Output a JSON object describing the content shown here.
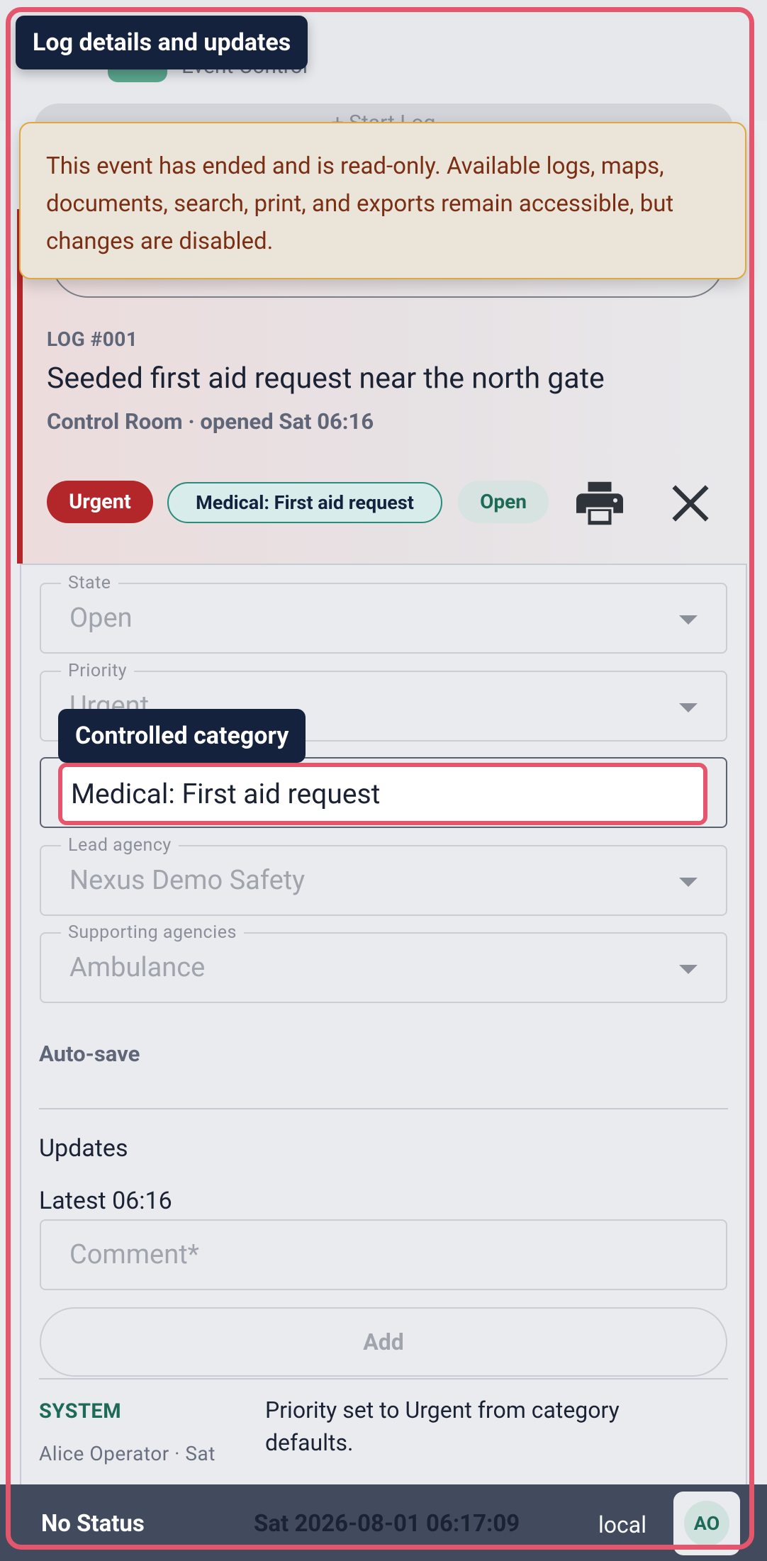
{
  "tooltips": {
    "top": "Log details and updates",
    "category": "Controlled category"
  },
  "background": {
    "app_name": "Event Control",
    "start_log": "+ Start Log"
  },
  "banner": {
    "text": "This event has ended and is read-only. Available logs, maps, documents, search, print, and exports remain accessible, but changes are disabled."
  },
  "log": {
    "number": "LOG #001",
    "title": "Seeded first aid request near the north gate",
    "subtitle": "Control Room · opened Sat 06:16",
    "chips": {
      "priority": "Urgent",
      "category": "Medical: First aid request",
      "state": "Open"
    },
    "icons": {
      "print": "print-icon",
      "close": "close-icon"
    }
  },
  "form": {
    "state": {
      "label": "State",
      "value": "Open"
    },
    "priority": {
      "label": "Priority",
      "value": "Urgent"
    },
    "category": {
      "value": "Medical: First aid request"
    },
    "lead_agency": {
      "label": "Lead agency",
      "value": "Nexus Demo Safety"
    },
    "supporting_agencies": {
      "label": "Supporting agencies",
      "value": "Ambulance"
    },
    "autosave": "Auto-save"
  },
  "updates": {
    "heading": "Updates",
    "latest": "Latest 06:16",
    "comment_placeholder": "Comment*",
    "add_label": "Add",
    "entries": [
      {
        "source": "SYSTEM",
        "author": "Alice Operator · Sat",
        "text": "Priority set to Urgent from category defaults."
      }
    ]
  },
  "status_bar": {
    "status": "No Status",
    "time": "Sat 2026-08-01 06:17:09",
    "zone": "local",
    "avatar_initials": "AO"
  },
  "colors": {
    "accent": "#e5566d",
    "urgent": "#b3272a",
    "navy": "#15223d",
    "teal": "#1d6a58",
    "warning_border": "#e0a83c"
  }
}
